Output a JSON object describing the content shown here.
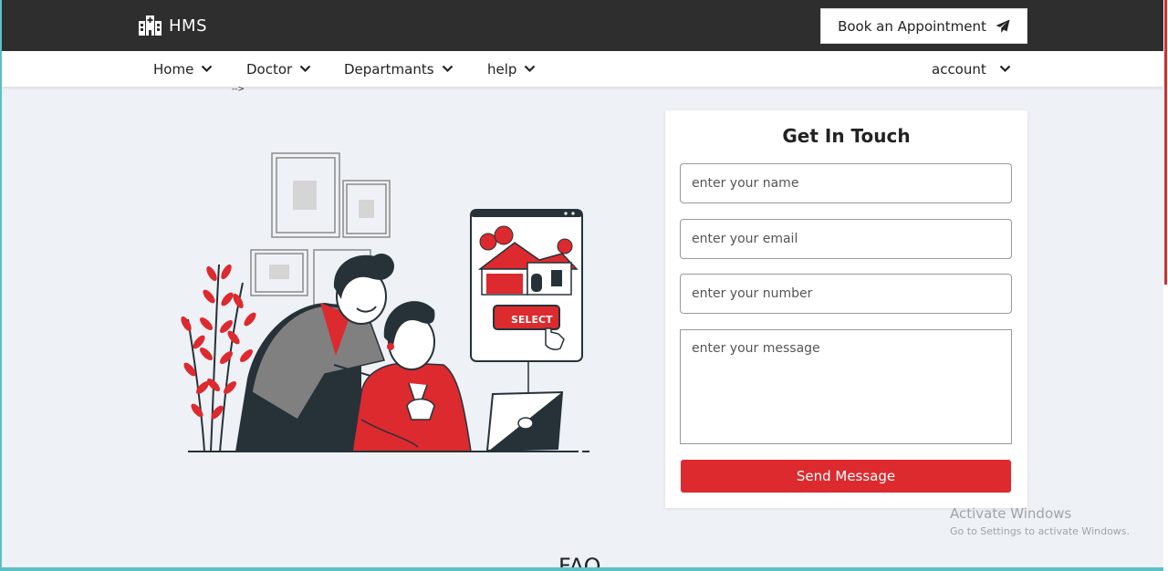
{
  "brand": {
    "name": "HMS",
    "icon": "hospital-icon"
  },
  "header": {
    "book_label": "Book an Appointment",
    "book_icon": "paper-plane-icon"
  },
  "nav": {
    "items": [
      {
        "label": "Home"
      },
      {
        "label": "Doctor"
      },
      {
        "label": "Departmants"
      },
      {
        "label": "help"
      }
    ],
    "account_label": "account"
  },
  "stray_text": "-->",
  "illustration": {
    "select_label": "SELECT"
  },
  "contact": {
    "title": "Get In Touch",
    "name_placeholder": "enter your name",
    "email_placeholder": "enter your email",
    "number_placeholder": "enter your number",
    "message_placeholder": "enter your message",
    "send_label": "Send Message"
  },
  "faq": {
    "title": "FAQ"
  },
  "watermark": {
    "title": "Activate Windows",
    "subtitle": "Go to Settings to activate Windows."
  },
  "colors": {
    "accent": "#dc2a2e",
    "topbar": "#2e2e2e",
    "background": "#eef1f6",
    "frame": "#5bc0c8"
  }
}
